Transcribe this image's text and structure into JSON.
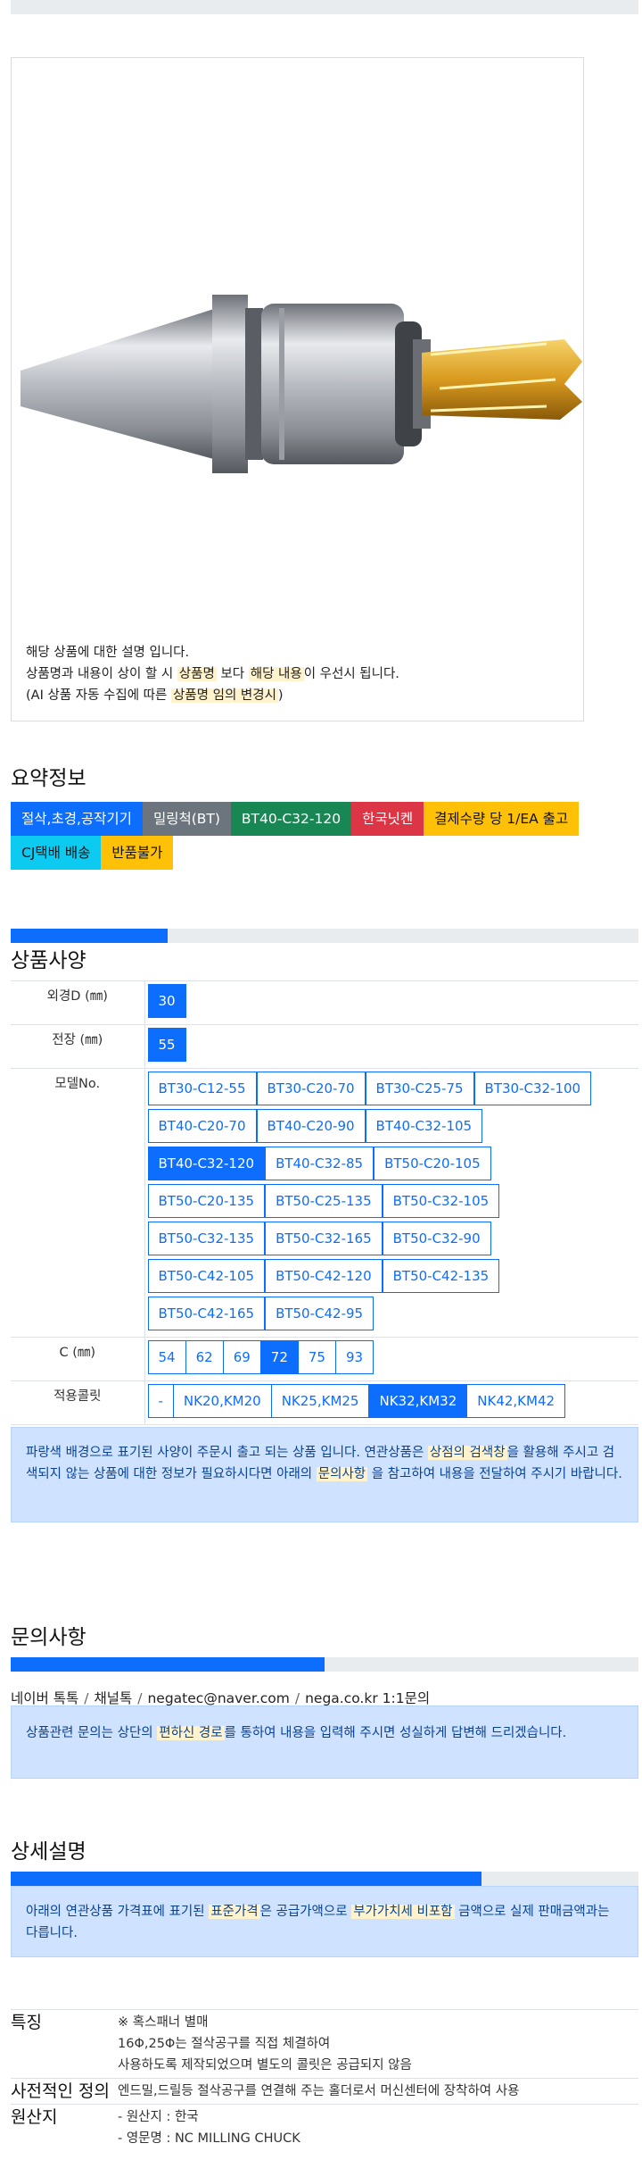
{
  "image_description": {
    "line1": "해당 상품에 대한 설명 입니다.",
    "line2_pre": "상품명과 내용이 상이 할 시 ",
    "line2_hl1": "상품명",
    "line2_mid": " 보다 ",
    "line2_hl2": "해당 내용",
    "line2_post": "이 우선시 됩니다.",
    "line3_pre": "(AI 상품 자동 수집에 따른 ",
    "line3_hl": "상품명 임의 변경시",
    "line3_post": ")"
  },
  "summary": {
    "title": "요약정보",
    "badges": [
      {
        "label": "절삭,초경,공작기기",
        "color": "#0d6efd"
      },
      {
        "label": "밀링척(BT)",
        "color": "#6c757d"
      },
      {
        "label": "BT40-C32-120",
        "color": "#198754"
      },
      {
        "label": "한국닛켄",
        "color": "#dc3545"
      },
      {
        "label": "결제수량 당 1/EA 출고",
        "color": "#ffc107"
      },
      {
        "label": "CJ택배 배송",
        "color": "#0dcaf0"
      },
      {
        "label": "반품불가",
        "color": "#ffc107"
      }
    ]
  },
  "spec": {
    "title": "상품사양",
    "progress": 0.25,
    "rows": [
      {
        "label": "외경D (㎜)",
        "options": [
          "30"
        ],
        "selected": "30",
        "group": false
      },
      {
        "label": "전장 (㎜)",
        "options": [
          "55"
        ],
        "selected": "55",
        "group": false
      },
      {
        "label": "모델No.",
        "group": false,
        "selected": "BT40-C32-120",
        "option_rows": [
          [
            "BT30-C12-55",
            "BT30-C20-70",
            "BT30-C25-75",
            "BT30-C32-100"
          ],
          [
            "BT40-C20-70",
            "BT40-C20-90",
            "BT40-C32-105"
          ],
          [
            "BT40-C32-120",
            "BT40-C32-85",
            "BT50-C20-105"
          ],
          [
            "BT50-C20-135",
            "BT50-C25-135",
            "BT50-C32-105"
          ],
          [
            "BT50-C32-135",
            "BT50-C32-165",
            "BT50-C32-90"
          ],
          [
            "BT50-C42-105",
            "BT50-C42-120",
            "BT50-C42-135"
          ],
          [
            "BT50-C42-165",
            "BT50-C42-95"
          ]
        ]
      },
      {
        "label": "C (㎜)",
        "options": [
          "54",
          "62",
          "69",
          "72",
          "75",
          "93"
        ],
        "selected": "72",
        "group": true
      },
      {
        "label": "적용콜릿",
        "options": [
          "-",
          "NK20,KM20",
          "NK25,KM25",
          "NK32,KM32",
          "NK42,KM42"
        ],
        "selected": "NK32,KM32",
        "group": true
      }
    ],
    "notice_pre": "파랑색 배경으로 표기된 사양이 주문시 출고 되는 상품 입니다. 연관상품은 ",
    "notice_hl1": "상점의 검색창",
    "notice_mid": "을 활용해 주시고 검색되지 않는 상품에 대한 정보가 필요하시다면 아래의 ",
    "notice_hl2": "문의사항",
    "notice_post": " 을 참고하여 내용을 전달하여 주시기 바랍니다."
  },
  "inquiry": {
    "title": "문의사항",
    "progress": 0.5,
    "contacts": [
      "네이버 톡톡",
      "채널톡",
      "negatec@naver.com",
      "nega.co.kr 1:1문의"
    ],
    "notice_pre": "상품관련 문의는 상단의 ",
    "notice_hl": "편하신 경로",
    "notice_post": "를 통하여 내용을 입력해 주시면 성실하게 답변해 드리겠습니다."
  },
  "details": {
    "title": "상세설명",
    "progress": 0.75,
    "notice_pre": "아래의 연관상품 가격표에 표기된 ",
    "notice_hl1": "표준가격",
    "notice_mid": "은 공급가액으로 ",
    "notice_hl2": "부가가치세 비포함",
    "notice_post": " 금액으로 실제 판매금액과는 다릅니다.",
    "rows": [
      {
        "label": "특징",
        "lines": [
          "※ 혹스패너 별매",
          "16Φ,25Φ는 절삭공구를 직접 체결하여",
          "사용하도록 제작되었으며 별도의 콜릿은 공급되지 않음"
        ]
      },
      {
        "label": "사전적인 정의",
        "lines": [
          "엔드밀,드릴등 절삭공구를 연결해 주는 홀더로서 머신센터에 장착하여 사용"
        ]
      },
      {
        "label": "원산지",
        "lines": [
          "- 원산지 : 한국",
          "- 영문명 : NC MILLING CHUCK"
        ]
      }
    ]
  }
}
